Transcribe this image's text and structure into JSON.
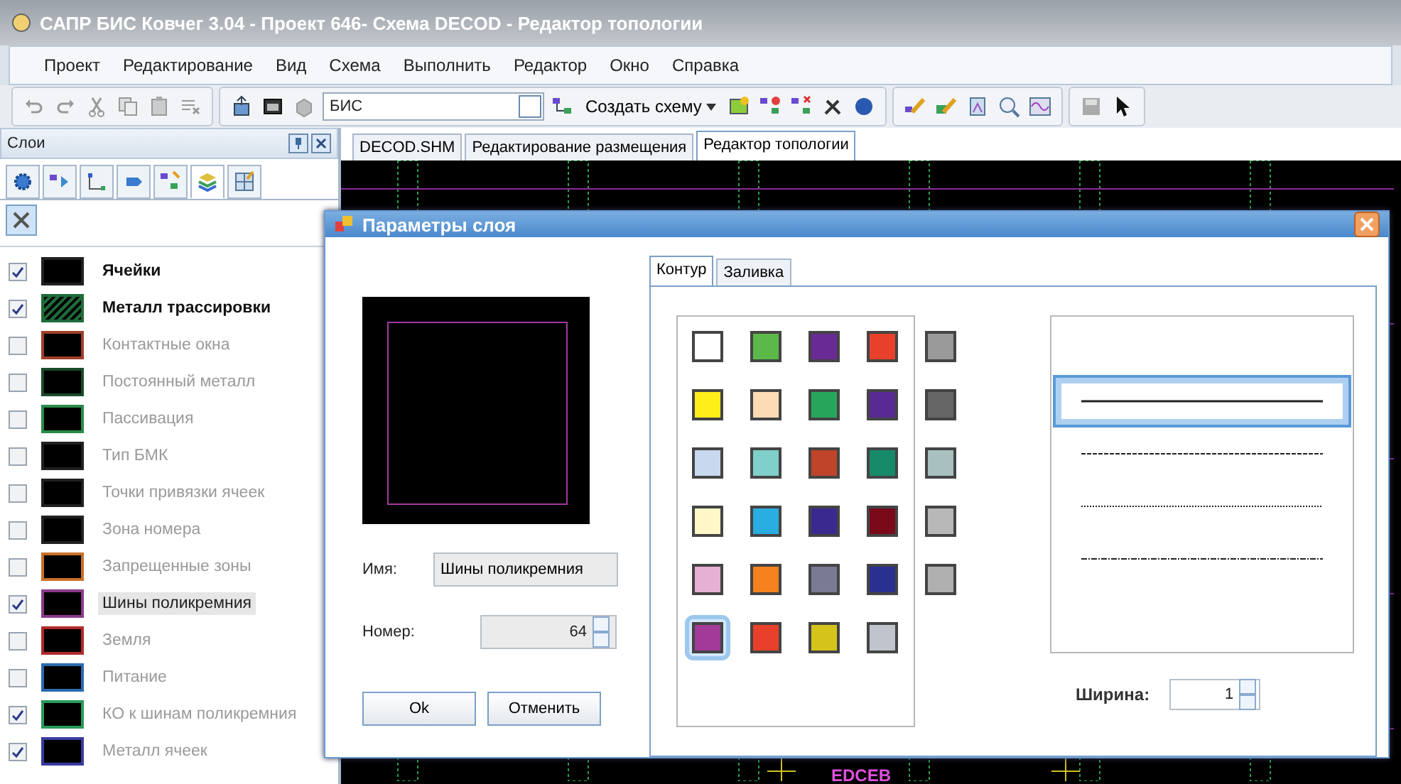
{
  "window": {
    "title": "САПР БИС Ковчег 3.04 - Проект 646- Схема DECOD - Редактор топологии"
  },
  "menu": [
    "Проект",
    "Редактирование",
    "Вид",
    "Схема",
    "Выполнить",
    "Редактор",
    "Окно",
    "Справка"
  ],
  "toolbar": {
    "combo_value": "БИС",
    "create_button": "Создать схему"
  },
  "layers_panel": {
    "title": "Слои",
    "icon_tabs": [
      {
        "selected": false
      },
      {
        "selected": false
      },
      {
        "selected": false
      },
      {
        "selected": false
      },
      {
        "selected": false
      },
      {
        "selected": true
      },
      {
        "selected": false
      }
    ],
    "layers": [
      {
        "name": "Ячейки",
        "checked": true,
        "emphasized": true,
        "selected": false,
        "kind": "solid",
        "color": "#202020"
      },
      {
        "name": "Металл трассировки",
        "checked": true,
        "emphasized": true,
        "selected": false,
        "kind": "hatched",
        "color": "#1e6b3a"
      },
      {
        "name": "Контактные окна",
        "checked": false,
        "emphasized": false,
        "selected": false,
        "kind": "solid",
        "color": "#a0402a"
      },
      {
        "name": "Постоянный металл",
        "checked": false,
        "emphasized": false,
        "selected": false,
        "kind": "solid",
        "color": "#1a4a2a"
      },
      {
        "name": "Пассивация",
        "checked": false,
        "emphasized": false,
        "selected": false,
        "kind": "solid",
        "color": "#2a8a4a"
      },
      {
        "name": "Тип БМК",
        "checked": false,
        "emphasized": false,
        "selected": false,
        "kind": "solid",
        "color": "#202020"
      },
      {
        "name": "Точки привязки ячеек",
        "checked": false,
        "emphasized": false,
        "selected": false,
        "kind": "solid",
        "color": "#202020"
      },
      {
        "name": "Зона номера",
        "checked": false,
        "emphasized": false,
        "selected": false,
        "kind": "solid",
        "color": "#202020"
      },
      {
        "name": "Запрещенные зоны",
        "checked": false,
        "emphasized": false,
        "selected": false,
        "kind": "solid",
        "color": "#c8702a"
      },
      {
        "name": "Шины поликремния",
        "checked": true,
        "emphasized": false,
        "selected": true,
        "kind": "solid",
        "color": "#8a3a8a"
      },
      {
        "name": "Земля",
        "checked": false,
        "emphasized": false,
        "selected": false,
        "kind": "solid",
        "color": "#b02a2a"
      },
      {
        "name": "Питание",
        "checked": false,
        "emphasized": false,
        "selected": false,
        "kind": "solid",
        "color": "#2a6ab0"
      },
      {
        "name": "КО к шинам поликремния",
        "checked": true,
        "emphasized": false,
        "selected": false,
        "kind": "solid",
        "color": "#2a9a5a"
      },
      {
        "name": "Металл ячеек",
        "checked": true,
        "emphasized": false,
        "selected": false,
        "kind": "solid",
        "color": "#3a3aa0"
      }
    ]
  },
  "document_tabs": [
    {
      "label": "DECOD.SHM",
      "selected": false
    },
    {
      "label": "Редактирование размещения",
      "selected": false
    },
    {
      "label": "Редактор топологии",
      "selected": true
    }
  ],
  "canvas_label": "EDCEB",
  "dialog": {
    "title": "Параметры слоя",
    "name_label": "Имя:",
    "name_value": "Шины поликремния",
    "number_label": "Номер:",
    "number_value": "64",
    "ok_button": "Ok",
    "cancel_button": "Отменить",
    "tabs": [
      {
        "label": "Контур",
        "selected": true
      },
      {
        "label": "Заливка",
        "selected": false
      }
    ],
    "palette": [
      {
        "color": "#ffffff",
        "selected": false
      },
      {
        "color": "#5bb94a",
        "selected": false
      },
      {
        "color": "#6a2a94",
        "selected": false
      },
      {
        "color": "#e8402a",
        "selected": false
      },
      {
        "color": "#9a9a9a",
        "selected": false
      },
      {
        "color": "#ffee1a",
        "selected": false
      },
      {
        "color": "#fbdcb4",
        "selected": false
      },
      {
        "color": "#26a65a",
        "selected": false
      },
      {
        "color": "#5a2a94",
        "selected": false
      },
      {
        "color": "#666666",
        "selected": false
      },
      {
        "color": "#c8d8ee",
        "selected": false
      },
      {
        "color": "#7fcfca",
        "selected": false
      },
      {
        "color": "#c0442a",
        "selected": false
      },
      {
        "color": "#178a6a",
        "selected": false
      },
      {
        "color": "#a8c0c0",
        "selected": false
      },
      {
        "color": "#fff7c8",
        "selected": false
      },
      {
        "color": "#2aaee0",
        "selected": false
      },
      {
        "color": "#3a2a90",
        "selected": false
      },
      {
        "color": "#7a0a1a",
        "selected": false
      },
      {
        "color": "#b8b8b8",
        "selected": false
      },
      {
        "color": "#e6b0d4",
        "selected": false
      },
      {
        "color": "#f5821e",
        "selected": false
      },
      {
        "color": "#7a7a92",
        "selected": false
      },
      {
        "color": "#2a3090",
        "selected": false
      },
      {
        "color": "#b0b0b0",
        "selected": false
      },
      {
        "color": "#a23a9a",
        "selected": true
      },
      {
        "color": "#e8402a",
        "selected": false
      },
      {
        "color": "#d4c41a",
        "selected": false
      },
      {
        "color": "#c0c4cc",
        "selected": false
      }
    ],
    "line_styles": [
      {
        "kind": "none",
        "selected": false
      },
      {
        "kind": "solid",
        "selected": true
      },
      {
        "kind": "dash",
        "selected": false
      },
      {
        "kind": "dot",
        "selected": false
      },
      {
        "kind": "dashdot",
        "selected": false
      }
    ],
    "width_label": "Ширина:",
    "width_value": "1"
  }
}
